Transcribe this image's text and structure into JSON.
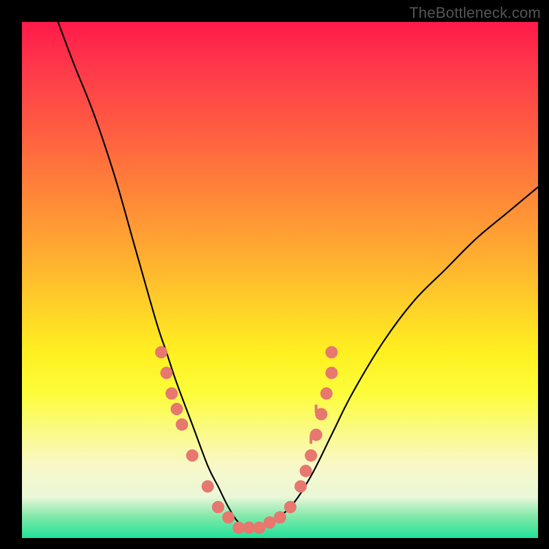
{
  "watermark": "TheBottleneck.com",
  "chart_data": {
    "type": "line",
    "title": "",
    "xlabel": "",
    "ylabel": "",
    "xlim": [
      0,
      100
    ],
    "ylim": [
      0,
      100
    ],
    "grid": false,
    "series": [
      {
        "name": "bottleneck-curve",
        "x": [
          7,
          10,
          14,
          18,
          22,
          26,
          28,
          30,
          33,
          36,
          38,
          40,
          42,
          44,
          46,
          48,
          52,
          56,
          60,
          64,
          70,
          76,
          82,
          88,
          94,
          100
        ],
        "y": [
          100,
          92,
          82,
          70,
          56,
          42,
          36,
          30,
          22,
          14,
          10,
          6,
          3,
          2,
          2,
          3,
          6,
          12,
          20,
          28,
          38,
          46,
          52,
          58,
          63,
          68
        ]
      }
    ],
    "markers": {
      "name": "sample-points",
      "color": "#e7776f",
      "points": [
        {
          "x": 27,
          "y": 36
        },
        {
          "x": 28,
          "y": 32
        },
        {
          "x": 29,
          "y": 28
        },
        {
          "x": 30,
          "y": 25
        },
        {
          "x": 31,
          "y": 22
        },
        {
          "x": 33,
          "y": 16
        },
        {
          "x": 36,
          "y": 10
        },
        {
          "x": 38,
          "y": 6
        },
        {
          "x": 40,
          "y": 4
        },
        {
          "x": 42,
          "y": 2
        },
        {
          "x": 44,
          "y": 2
        },
        {
          "x": 46,
          "y": 2
        },
        {
          "x": 48,
          "y": 3
        },
        {
          "x": 50,
          "y": 4
        },
        {
          "x": 52,
          "y": 6
        },
        {
          "x": 54,
          "y": 10
        },
        {
          "x": 55,
          "y": 13
        },
        {
          "x": 56,
          "y": 16
        },
        {
          "x": 57,
          "y": 20
        },
        {
          "x": 58,
          "y": 24
        },
        {
          "x": 59,
          "y": 28
        },
        {
          "x": 60,
          "y": 32
        },
        {
          "x": 60,
          "y": 36
        }
      ]
    }
  }
}
